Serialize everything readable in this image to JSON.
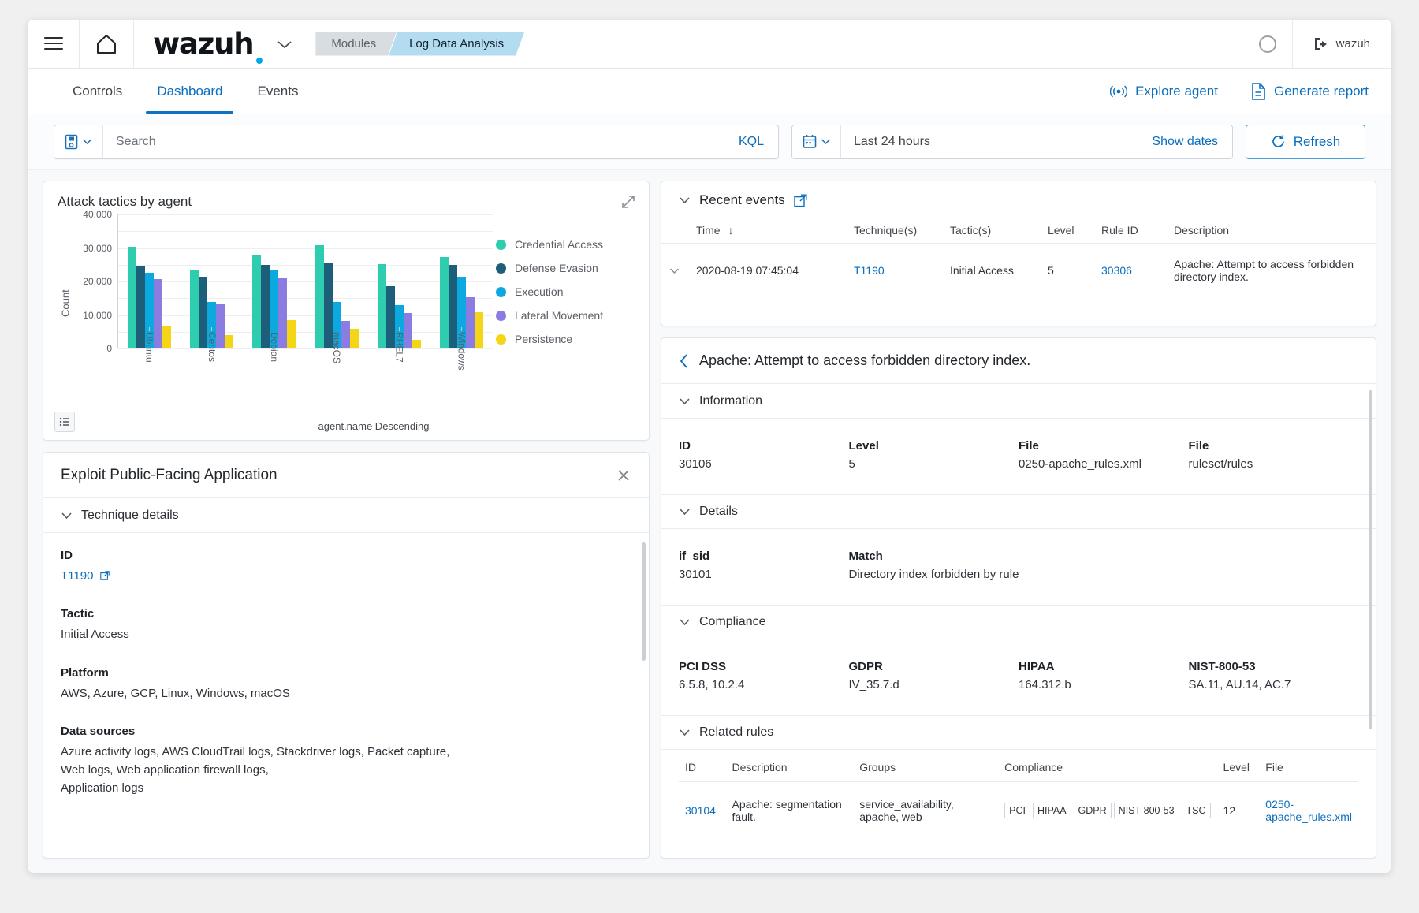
{
  "topbar": {
    "menu_icon": "hamburger-icon",
    "home_icon": "home-icon",
    "brand": "wazuh",
    "brand_caret": "chevron-down-icon",
    "breadcrumbs": [
      {
        "label": "Modules",
        "active": false
      },
      {
        "label": "Log Data Analysis",
        "active": true
      }
    ],
    "status_icon": "loading-circle-icon",
    "user_icon": "logout-icon",
    "user": "wazuh"
  },
  "nav": {
    "tabs": [
      {
        "label": "Controls",
        "active": false
      },
      {
        "label": "Dashboard",
        "active": true
      },
      {
        "label": "Events",
        "active": false
      }
    ],
    "links": [
      {
        "label": "Explore agent",
        "icon": "agent-signal-icon"
      },
      {
        "label": "Generate report",
        "icon": "document-icon"
      }
    ]
  },
  "searchbar": {
    "saved_query_icon": "saved-query-icon",
    "placeholder": "Search",
    "value": "",
    "language": "KQL",
    "calendar_icon": "calendar-icon",
    "date_range": "Last 24 hours",
    "show_dates": "Show dates",
    "refresh": "Refresh",
    "refresh_icon": "refresh-icon"
  },
  "chart_panel": {
    "title": "Attack tactics by agent",
    "expand_icon": "expand-icon",
    "list_icon": "list-view-icon"
  },
  "chart_data": {
    "type": "bar",
    "title": "Attack tactics by agent",
    "xlabel": "agent.name Descending",
    "ylabel": "Count",
    "ylim": [
      0,
      40000
    ],
    "yticks": [
      0,
      10000,
      20000,
      30000,
      40000
    ],
    "ytick_labels": [
      "0",
      "10,000",
      "20,000",
      "30,000",
      "40,000"
    ],
    "grid": true,
    "legend_position": "right",
    "categories": [
      "Ubuntu",
      "Centos",
      "Debian",
      "macOS",
      "RHEL7",
      "Windows"
    ],
    "series": [
      {
        "name": "Credential Access",
        "color": "#2ecdb0",
        "values": [
          30300,
          23600,
          27700,
          30900,
          25200,
          27300
        ]
      },
      {
        "name": "Defense Evasion",
        "color": "#1d5f7a",
        "values": [
          24600,
          21500,
          25000,
          25700,
          18700,
          25000
        ]
      },
      {
        "name": "Execution",
        "color": "#0ba9e0",
        "values": [
          22600,
          13800,
          23200,
          14000,
          13000,
          21300
        ]
      },
      {
        "name": "Lateral Movement",
        "color": "#8a7ce0",
        "values": [
          20700,
          13100,
          21000,
          8200,
          10500,
          15400
        ]
      },
      {
        "name": "Persistence",
        "color": "#f5d616",
        "values": [
          6500,
          4000,
          8500,
          6000,
          2500,
          10800
        ]
      }
    ]
  },
  "technique_panel": {
    "title": "Exploit Public-Facing Application",
    "close_icon": "close-icon",
    "section": "Technique details",
    "chevron_icon": "chevron-down-icon",
    "fields": [
      {
        "label": "ID",
        "value": "T1190",
        "link": true,
        "external_icon": "external-link-icon"
      },
      {
        "label": "Tactic",
        "value": "Initial Access",
        "link": false
      },
      {
        "label": "Platform",
        "value": "AWS, Azure, GCP, Linux, Windows, macOS",
        "link": false
      },
      {
        "label": "Data sources",
        "value": "Azure activity logs, AWS CloudTrail logs, Stackdriver logs, Packet capture,\nWeb logs, Web application firewall logs,\nApplication logs",
        "link": false
      }
    ]
  },
  "recent_events": {
    "title": "Recent events",
    "external_icon": "external-link-icon",
    "chevron_icon": "chevron-down-icon",
    "columns": [
      "Time",
      "Technique(s)",
      "Tactic(s)",
      "Level",
      "Rule ID",
      "Description"
    ],
    "sort_icon": "sort-down-arrow-icon",
    "rows": [
      {
        "row_chevron": "chevron-down-icon",
        "time": "2020-08-19 07:45:04",
        "techniques": "T1190",
        "tactics": "Initial Access",
        "level": "5",
        "rule_id": "30306",
        "description": "Apache: Attempt to access forbidden directory index."
      }
    ]
  },
  "rule_detail": {
    "back_icon": "chevron-left-icon",
    "title": "Apache: Attempt to access forbidden directory index.",
    "sections": {
      "information": {
        "label": "Information",
        "fields": [
          {
            "label": "ID",
            "value": "30106",
            "link": false
          },
          {
            "label": "Level",
            "value": "5",
            "link": true
          },
          {
            "label": "File",
            "value": "0250-apache_rules.xml",
            "link": true
          },
          {
            "label": "File",
            "value": "ruleset/rules",
            "link": true
          }
        ]
      },
      "details": {
        "label": "Details",
        "fields": [
          {
            "label": "if_sid",
            "value": "30101",
            "link": false
          },
          {
            "label": "Match",
            "value": "Directory index forbidden by rule",
            "link": false
          }
        ]
      },
      "compliance": {
        "label": "Compliance",
        "fields": [
          {
            "label": "PCI DSS",
            "value": "6.5.8, 10.2.4",
            "link": true
          },
          {
            "label": "GDPR",
            "value": "IV_35.7.d",
            "link": true
          },
          {
            "label": "HIPAA",
            "value": "164.312.b",
            "link": true
          },
          {
            "label": "NIST-800-53",
            "value": "SA.11, AU.14, AC.7",
            "link": true
          }
        ]
      },
      "related_rules": {
        "label": "Related rules",
        "columns": [
          "ID",
          "Description",
          "Groups",
          "Compliance",
          "Level",
          "File"
        ],
        "rows": [
          {
            "id": "30104",
            "description": "Apache: segmentation fault.",
            "groups": "service_availability, apache, web",
            "compliance": [
              "PCI",
              "HIPAA",
              "GDPR",
              "NIST-800-53",
              "TSC"
            ],
            "level": "12",
            "file": "0250-apache_rules.xml"
          }
        ]
      }
    }
  },
  "colors": {
    "link": "#0b6ebd",
    "accent": "#00a9e5",
    "breadcrumb_active_bg": "#b3dcf0"
  }
}
